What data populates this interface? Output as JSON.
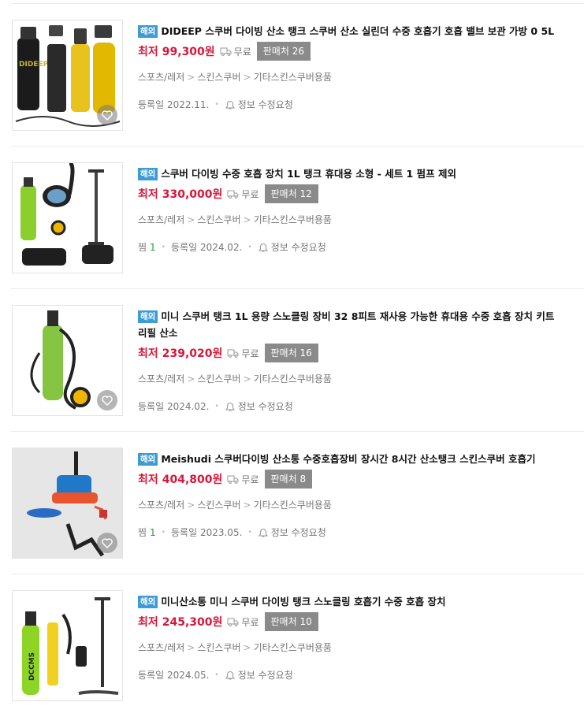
{
  "labels": {
    "overseas_badge": "해외",
    "lowest_price": "최저",
    "free_shipping": "무료",
    "registered": "등록일",
    "info_edit": "정보 수정요청",
    "zzim": "찜"
  },
  "products": [
    {
      "title": "DIDEEP 스쿠버 다이빙 산소 탱크 스쿠버 산소 실린더 수중 호흡기 호흡 밸브 보관 가방 0 5L",
      "price": "99,300원",
      "sellers": "판매처 26",
      "category": [
        "스포츠/레저",
        "스킨스쿠버",
        "기타스킨스쿠버용품"
      ],
      "zzim_count": null,
      "date": "2022.11."
    },
    {
      "title": "스쿠버 다이빙 수중 호흡 장치 1L 탱크 휴대용 소형 - 세트 1 펌프 제외",
      "price": "330,000원",
      "sellers": "판매처 12",
      "category": [
        "스포츠/레저",
        "스킨스쿠버",
        "기타스킨스쿠버용품"
      ],
      "zzim_count": "1",
      "date": "2024.02."
    },
    {
      "title": "미니 스쿠버 탱크 1L 용량 스노클링 장비 32 8피트 재사용 가능한 휴대용 수중 호흡 장치 키트 리필 산소",
      "price": "239,020원",
      "sellers": "판매처 16",
      "category": [
        "스포츠/레저",
        "스킨스쿠버",
        "기타스킨스쿠버용품"
      ],
      "zzim_count": null,
      "date": "2024.02."
    },
    {
      "title": "Meishudi 스쿠버다이빙 산소통 수중호흡장비 장시간 8시간 산소탱크 스킨스쿠버 호흡기",
      "price": "404,800원",
      "sellers": "판매처 8",
      "category": [
        "스포츠/레저",
        "스킨스쿠버",
        "기타스킨스쿠버용품"
      ],
      "zzim_count": "1",
      "date": "2023.05."
    },
    {
      "title": "미니산소통 미니 스쿠버 다이빙 탱크 스노클링 호흡기 수중 호흡 장치",
      "price": "245,300원",
      "sellers": "판매처 10",
      "category": [
        "스포츠/레저",
        "스킨스쿠버",
        "기타스킨스쿠버용품"
      ],
      "zzim_count": null,
      "date": "2024.05."
    }
  ],
  "image_text": {
    "p1_brand": "DIDEEP",
    "p5_brand": "DCCMS"
  },
  "colors": {
    "price_red": "#d4183b",
    "badge_blue": "#3d9bd6",
    "seller_gray": "#8a8a8a",
    "zzim_green": "#2b9b4a"
  }
}
